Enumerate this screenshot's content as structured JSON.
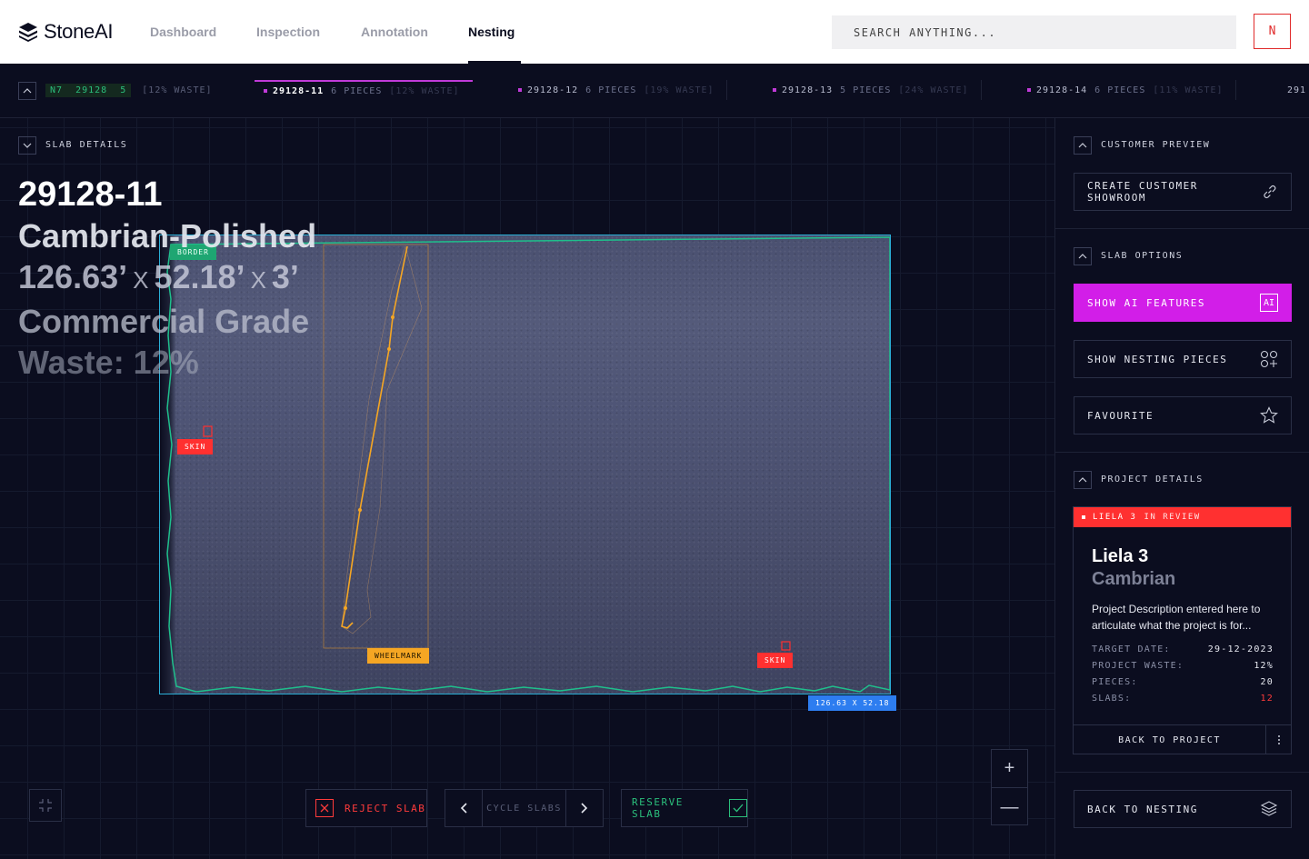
{
  "app": {
    "name": "StoneAI"
  },
  "nav": {
    "items": [
      "Dashboard",
      "Inspection",
      "Annotation",
      "Nesting"
    ],
    "active": "Nesting"
  },
  "search": {
    "placeholder": "SEARCH ANYTHING..."
  },
  "user": {
    "initial": "N"
  },
  "tabs": {
    "summary": {
      "tag": "N7",
      "job": "29128",
      "count": "5",
      "waste": "[12% WASTE]"
    },
    "slabs": [
      {
        "id": "29128-11",
        "pieces": "6 PIECES",
        "waste": "[12% WASTE]",
        "active": true
      },
      {
        "id": "29128-12",
        "pieces": "6 PIECES",
        "waste": "[19% WASTE]"
      },
      {
        "id": "29128-13",
        "pieces": "5 PIECES",
        "waste": "[24% WASTE]"
      },
      {
        "id": "29128-14",
        "pieces": "6 PIECES",
        "waste": "[11% WASTE]"
      },
      {
        "id": "291"
      }
    ]
  },
  "slab_details": {
    "section_label": "SLAB DETAILS",
    "id": "29128-11",
    "material": "Cambrian-Polished",
    "dim_a": "126.63’",
    "dim_b": "52.18’",
    "dim_c": "3’",
    "dim_sep": "X",
    "grade": "Commercial Grade",
    "waste": "Waste: 12%"
  },
  "annotations": {
    "border": "BORDER",
    "skin_left": "SKIN",
    "skin_right": "SKIN",
    "wheelmark": "WHEELMARK",
    "dimensions": "126.63 X 52.18"
  },
  "controls": {
    "reject": "REJECT SLAB",
    "cycle": "CYCLE SLABS",
    "reserve": "RESERVE SLAB",
    "zoom_in": "+",
    "zoom_out": "—"
  },
  "right_panel": {
    "customer_preview": {
      "label": "CUSTOMER PREVIEW",
      "button": "CREATE CUSTOMER SHOWROOM"
    },
    "slab_options": {
      "label": "SLAB OPTIONS",
      "show_ai": "SHOW AI FEATURES",
      "ai_badge": "AI",
      "show_nesting": "SHOW NESTING PIECES",
      "favourite": "FAVOURITE"
    },
    "project_details": {
      "label": "PROJECT DETAILS",
      "header_name": "LIELA 3",
      "header_status": "IN REVIEW",
      "title": "Liela 3",
      "subtitle": "Cambrian",
      "description": "Project Description entered here to articulate what the project is for...",
      "rows": [
        {
          "key": "TARGET DATE:",
          "value": "29-12-2023"
        },
        {
          "key": "PROJECT WASTE:",
          "value": "12%"
        },
        {
          "key": "PIECES:",
          "value": "20"
        },
        {
          "key": "SLABS:",
          "value": "12"
        }
      ],
      "back_button": "BACK TO PROJECT"
    },
    "back_to_nesting": "BACK TO NESTING"
  },
  "colors": {
    "accent_magenta": "#d21ee8",
    "danger_red": "#ff3030",
    "success_green": "#2bbf7c",
    "wheelmark_orange": "#f5a623",
    "dimension_blue": "#2d7df0",
    "background": "#0b0d1f"
  }
}
